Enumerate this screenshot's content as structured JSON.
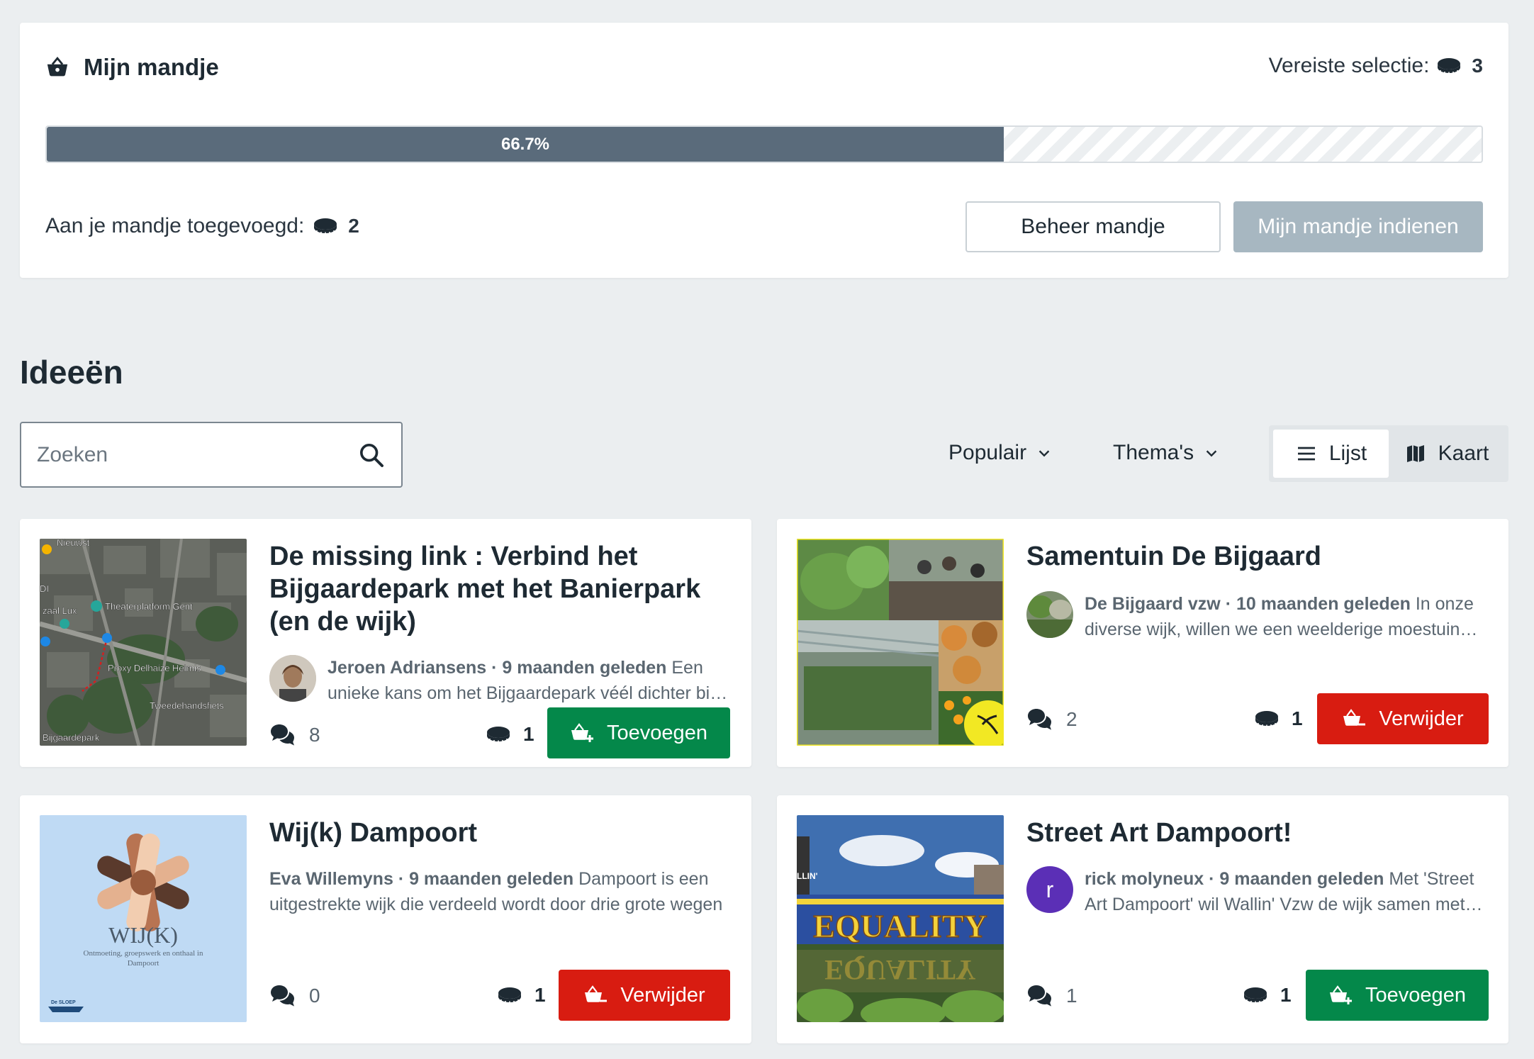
{
  "basket": {
    "title": "Mijn mandje",
    "required_label": "Vereiste selectie:",
    "required_count": "3",
    "progress_label": "66.7%",
    "progress_fraction": 0.667,
    "added_label": "Aan je mandje toegevoegd:",
    "added_count": "2",
    "manage_label": "Beheer mandje",
    "submit_label": "Mijn mandje indienen"
  },
  "ideas": {
    "title": "Ideeën",
    "search_placeholder": "Zoeken",
    "sort_label": "Populair",
    "themes_label": "Thema's",
    "view_list": "Lijst",
    "view_map": "Kaart"
  },
  "cards": [
    {
      "title": "De missing link : Verbind het Bijgaardepark met het Banierpark (en de wijk)",
      "author": "Jeroen Adriansens",
      "time": "· 9 maanden geleden",
      "excerpt": "Een unieke kans om het Bijgaardepark véél dichter bij de wijk te brengen",
      "comments": "8",
      "votes": "1",
      "action": "Toevoegen",
      "map_labels": [
        "Nieuwst",
        "Theaterplatform Gent",
        "zaal Lux",
        "Proxy Delhaize Heirnis",
        "Tweedehandsfiets",
        "Bijgaardepark",
        "DI"
      ]
    },
    {
      "title": "Samentuin De Bijgaard",
      "author": "De Bijgaard vzw",
      "time": "· 10 maanden geleden",
      "excerpt": "In onze diverse wijk, willen we een weelderige moestuin aanleggen",
      "comments": "2",
      "votes": "1",
      "action": "Verwijder"
    },
    {
      "title": "Wij(k) Dampoort",
      "author": "Eva Willemyns",
      "time": "· 9 maanden geleden",
      "excerpt": "Dampoort is een uitgestrekte wijk die verdeeld wordt door drie grote wegen",
      "comments": "0",
      "votes": "1",
      "action": "Verwijder",
      "thumb_title": "WIJ(K)",
      "thumb_sub": "Ontmoeting, groepswerk en onthaal in Dampoort",
      "thumb_logo": "De SLOEP"
    },
    {
      "title": "Street Art Dampoort!",
      "author": "rick molyneux",
      "time": "· 9 maanden geleden",
      "excerpt": "Met 'Street Art Dampoort' wil Wallin' Vzw de wijk samen met bewoners kleuren",
      "comments": "1",
      "votes": "1",
      "action": "Toevoegen",
      "avatar_letter": "r",
      "thumb_text": "EQUALITY",
      "thumb_tag": "LLIN'"
    }
  ],
  "colors": {
    "add": "#04884a",
    "remove": "#d81c11",
    "progress": "#5a6b7b",
    "submit_disabled": "#a7b7c1"
  }
}
